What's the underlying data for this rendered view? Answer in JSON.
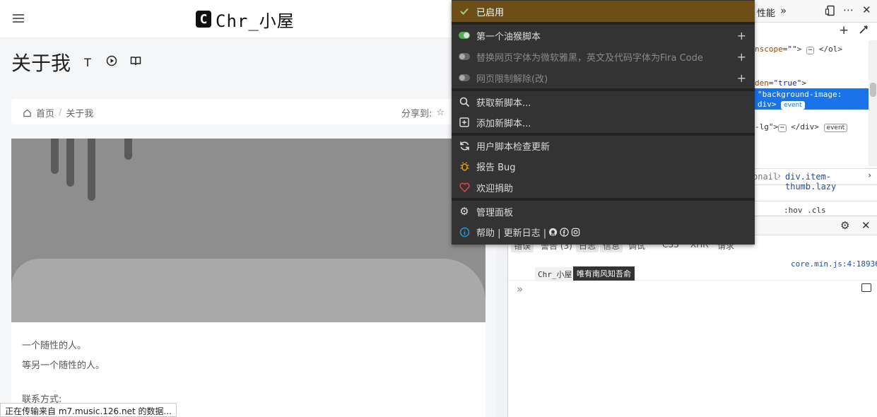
{
  "page": {
    "logo_mark": "C",
    "logo_text": "Chr_小屋",
    "title": "关于我",
    "title_tools": [
      "T",
      "▶",
      "📖"
    ],
    "breadcrumb": {
      "home": "首页",
      "sep": "/",
      "current": "关于我"
    },
    "share_label": "分享到:",
    "paragraphs": [
      "一个随性的人。",
      "等另一个随性的人。",
      "联系方式:"
    ],
    "status_text": "正在传输来自 m7.music.126.net 的数据..."
  },
  "popup": {
    "enabled_label": "已启用",
    "scripts": [
      {
        "label": "第一个油猴脚本",
        "enabled": true
      },
      {
        "label": "替换网页字体为微软雅黑，英文及代码字体为Fira Code",
        "enabled": false
      },
      {
        "label": "网页限制解除(改)",
        "enabled": false
      }
    ],
    "get_scripts": "获取新脚本...",
    "add_script": "添加新脚本...",
    "check_updates": "用户脚本检查更新",
    "report_bug": "报告 Bug",
    "donate": "欢迎捐助",
    "dashboard": "管理面板",
    "help": "帮助 | 更新日志 |",
    "colors": {
      "enabled_bg": "#6e4e17",
      "toggle_on": "#4caf50",
      "bug_icon": "#e0a020",
      "heart_icon": "#e04040",
      "info_icon": "#1e9bd7"
    }
  },
  "devtools": {
    "perf_tab": "性能",
    "elements_lines": {
      "l1_attr": "nscope",
      "l1_val": "\"\"",
      "l1_close": "</ol>",
      "l2_attr": "den",
      "l2_val": "\"true\"",
      "sel1": "\"background-image:",
      "sel2": "div>",
      "sel_badge": "event",
      "l4_text": "-lg\">",
      "l4_close": "</div>",
      "l4_badge": "event"
    },
    "path": {
      "prev": "onail",
      "current": "div.item-thumb.lazy"
    },
    "styles_toolbar": ":hov .cls",
    "filters": [
      "错误",
      "警告 (3)",
      "日志",
      "信息",
      "调试",
      "CSS",
      "XHR",
      "请求"
    ],
    "log_source": "core.min.js:4:18936",
    "log_message": "Chr_小屋",
    "log_tooltip": "唯有南风知吾俞"
  }
}
